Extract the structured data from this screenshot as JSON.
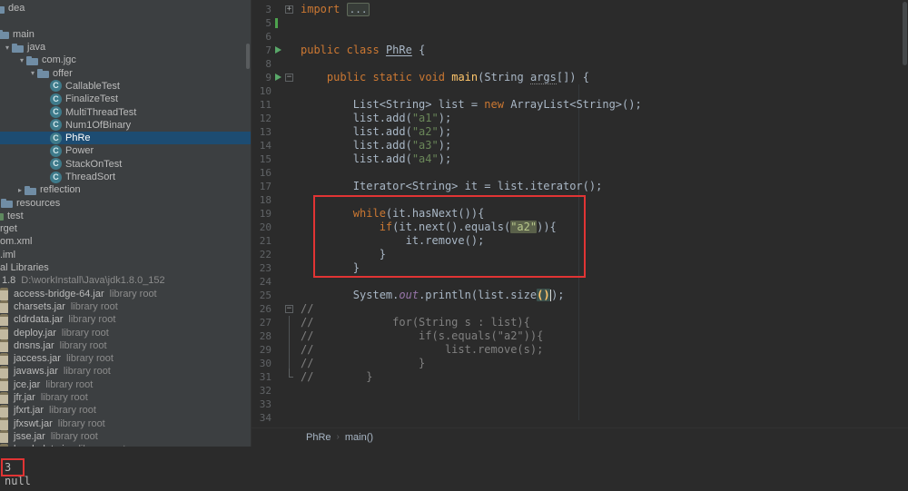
{
  "colors": {
    "editor_background": "#2b2b2b",
    "panel_background": "#3c3f41",
    "tree_selection": "#1d4c72",
    "keyword": "#cc7832",
    "string": "#6a8759",
    "comment": "#808080",
    "method_declaration": "#ffc66b",
    "field_italic": "#9876aa",
    "line_number": "#606366",
    "annotation_red": "#e13434",
    "vcs_green": "#59a869"
  },
  "project_tree": {
    "items": [
      {
        "label": "dea",
        "icon": "folder",
        "indent": -8
      },
      {
        "type": "spacer"
      },
      {
        "label": "main",
        "icon": "folder",
        "arrow": "down",
        "indent": -13
      },
      {
        "label": "java",
        "icon": "folder",
        "arrow": "down",
        "indent": 3
      },
      {
        "label": "com.jgc",
        "icon": "package",
        "arrow": "down",
        "indent": 19
      },
      {
        "label": "offer",
        "icon": "package",
        "arrow": "down",
        "indent": 31
      },
      {
        "label": "CallableTest",
        "icon": "class",
        "indent": 55
      },
      {
        "label": "FinalizeTest",
        "icon": "class",
        "indent": 55
      },
      {
        "label": "MultiThreadTest",
        "icon": "class",
        "indent": 55
      },
      {
        "label": "Num1OfBinary",
        "icon": "class",
        "indent": 55
      },
      {
        "label": "PhRe",
        "icon": "class",
        "indent": 55,
        "selected": true
      },
      {
        "label": "Power",
        "icon": "class",
        "indent": 55
      },
      {
        "label": "StackOnTest",
        "icon": "class",
        "indent": 55
      },
      {
        "label": "ThreadSort",
        "icon": "class",
        "indent": 55
      },
      {
        "label": "reflection",
        "icon": "package",
        "arrow": "right",
        "indent": 17
      },
      {
        "label": "resources",
        "icon": "folder",
        "indent": 1
      },
      {
        "label": "test",
        "icon": "folder-test",
        "indent": -9
      },
      {
        "label": "rget",
        "indent": 0
      },
      {
        "label": "om.xml",
        "indent": 0
      },
      {
        "label": ".iml",
        "indent": 0
      },
      {
        "label": "al Libraries",
        "indent": 0
      },
      {
        "label": "1.8",
        "sub": "D:\\workInstall\\Java\\jdk1.8.0_152",
        "indent": 2
      },
      {
        "label": "access-bridge-64.jar",
        "sub": "library root",
        "icon": "jar",
        "indent": -2
      },
      {
        "label": "charsets.jar",
        "sub": "library root",
        "icon": "jar",
        "indent": -2
      },
      {
        "label": "cldrdata.jar",
        "sub": "library root",
        "icon": "jar",
        "indent": -2
      },
      {
        "label": "deploy.jar",
        "sub": "library root",
        "icon": "jar",
        "indent": -2
      },
      {
        "label": "dnsns.jar",
        "sub": "library root",
        "icon": "jar",
        "indent": -2
      },
      {
        "label": "jaccess.jar",
        "sub": "library root",
        "icon": "jar",
        "indent": -2
      },
      {
        "label": "javaws.jar",
        "sub": "library root",
        "icon": "jar",
        "indent": -2
      },
      {
        "label": "jce.jar",
        "sub": "library root",
        "icon": "jar",
        "indent": -2
      },
      {
        "label": "jfr.jar",
        "sub": "library root",
        "icon": "jar",
        "indent": -2
      },
      {
        "label": "jfxrt.jar",
        "sub": "library root",
        "icon": "jar",
        "indent": -2
      },
      {
        "label": "jfxswt.jar",
        "sub": "library root",
        "icon": "jar",
        "indent": -2
      },
      {
        "label": "jsse.jar",
        "sub": "library root",
        "icon": "jar",
        "indent": -2
      },
      {
        "label": "localedata.jar",
        "sub": "library root",
        "icon": "jar",
        "indent": -2
      }
    ]
  },
  "editor": {
    "lines": [
      {
        "n": "3",
        "fold": "plus",
        "tokens": [
          [
            "kw",
            "import"
          ],
          [
            "plain",
            " "
          ],
          [
            "fold",
            "..."
          ]
        ]
      },
      {
        "n": "5",
        "vcs": "bar",
        "tokens": []
      },
      {
        "n": "6",
        "tokens": []
      },
      {
        "n": "7",
        "vcs": "run",
        "tokens": [
          [
            "kw",
            "public"
          ],
          [
            "plain",
            " "
          ],
          [
            "kw",
            "class"
          ],
          [
            "plain",
            " "
          ],
          [
            "cls",
            "PhRe"
          ],
          [
            "plain",
            " {"
          ]
        ]
      },
      {
        "n": "8",
        "tokens": []
      },
      {
        "n": "9",
        "vcs": "run",
        "fold": "minus",
        "tokens": [
          [
            "plain",
            "    "
          ],
          [
            "kw",
            "public"
          ],
          [
            "plain",
            " "
          ],
          [
            "kw",
            "static"
          ],
          [
            "plain",
            " "
          ],
          [
            "kw",
            "void"
          ],
          [
            "plain",
            " "
          ],
          [
            "fn",
            "main"
          ],
          [
            "plain",
            "(String "
          ],
          [
            "param",
            "args"
          ],
          [
            "plain",
            "[]) {"
          ]
        ]
      },
      {
        "n": "10",
        "tokens": []
      },
      {
        "n": "11",
        "tokens": [
          [
            "plain",
            "        List<String> list = "
          ],
          [
            "kw",
            "new"
          ],
          [
            "plain",
            " ArrayList<String>();"
          ]
        ]
      },
      {
        "n": "12",
        "tokens": [
          [
            "plain",
            "        list.add("
          ],
          [
            "str",
            "\"a1\""
          ],
          [
            "plain",
            ");"
          ]
        ]
      },
      {
        "n": "13",
        "tokens": [
          [
            "plain",
            "        list.add("
          ],
          [
            "str",
            "\"a2\""
          ],
          [
            "plain",
            ");"
          ]
        ]
      },
      {
        "n": "14",
        "tokens": [
          [
            "plain",
            "        list.add("
          ],
          [
            "str",
            "\"a3\""
          ],
          [
            "plain",
            ");"
          ]
        ]
      },
      {
        "n": "15",
        "tokens": [
          [
            "plain",
            "        list.add("
          ],
          [
            "str",
            "\"a4\""
          ],
          [
            "plain",
            ");"
          ]
        ]
      },
      {
        "n": "16",
        "tokens": []
      },
      {
        "n": "17",
        "tokens": [
          [
            "plain",
            "        Iterator<String> it = list.iterator();"
          ]
        ]
      },
      {
        "n": "18",
        "tokens": []
      },
      {
        "n": "19",
        "tokens": [
          [
            "plain",
            "        "
          ],
          [
            "kw",
            "while"
          ],
          [
            "plain",
            "(it.hasNext()){"
          ]
        ]
      },
      {
        "n": "20",
        "tokens": [
          [
            "plain",
            "            "
          ],
          [
            "kw",
            "if"
          ],
          [
            "plain",
            "(it.next().equals("
          ],
          [
            "strhl",
            "\"a2\""
          ],
          [
            "plain",
            ")){"
          ]
        ]
      },
      {
        "n": "21",
        "tokens": [
          [
            "plain",
            "                it.remove();"
          ]
        ]
      },
      {
        "n": "22",
        "tokens": [
          [
            "plain",
            "            }"
          ]
        ]
      },
      {
        "n": "23",
        "tokens": [
          [
            "plain",
            "        }"
          ]
        ]
      },
      {
        "n": "24",
        "tokens": []
      },
      {
        "n": "25",
        "tokens": [
          [
            "plain",
            "        System."
          ],
          [
            "field",
            "out"
          ],
          [
            "plain",
            ".println(list.size"
          ],
          [
            "parenhl",
            "()"
          ],
          [
            "caret",
            ""
          ],
          [
            "plain",
            ");"
          ]
        ]
      },
      {
        "n": "26",
        "fold": "minus",
        "tokens": [
          [
            "cmt",
            "//"
          ]
        ]
      },
      {
        "n": "27",
        "fold": "line",
        "tokens": [
          [
            "cmt",
            "//            for(String s : list){"
          ]
        ]
      },
      {
        "n": "28",
        "fold": "line",
        "tokens": [
          [
            "cmt",
            "//                if(s.equals(\"a2\")){"
          ]
        ]
      },
      {
        "n": "29",
        "fold": "line",
        "tokens": [
          [
            "cmt",
            "//                    list.remove(s);"
          ]
        ]
      },
      {
        "n": "30",
        "fold": "line",
        "tokens": [
          [
            "cmt",
            "//                }"
          ]
        ]
      },
      {
        "n": "31",
        "fold": "end",
        "tokens": [
          [
            "cmt",
            "//        }"
          ]
        ]
      },
      {
        "n": "32",
        "tokens": []
      },
      {
        "n": "33",
        "tokens": []
      },
      {
        "n": "34",
        "tokens": []
      }
    ]
  },
  "breadcrumbs": {
    "items": [
      "PhRe",
      "main()"
    ]
  },
  "console": {
    "lines": [
      {
        "text": "3",
        "boxed": true
      },
      {
        "text": "null",
        "boxed": false
      }
    ]
  },
  "annotations": {
    "color": "#e13434",
    "boxes": [
      "while-loop-block",
      "console-output-3"
    ]
  }
}
